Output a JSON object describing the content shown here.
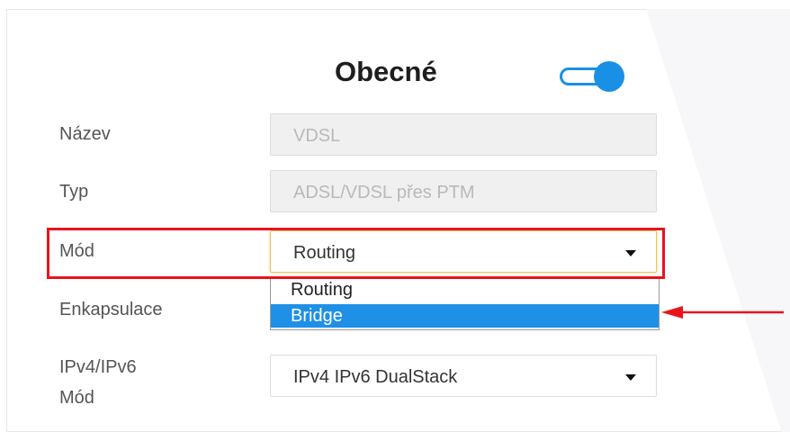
{
  "section": {
    "title": "Obecné",
    "enabled": true
  },
  "form": {
    "name": {
      "label": "Název",
      "value": "VDSL"
    },
    "type": {
      "label": "Typ",
      "value": "ADSL/VDSL přes PTM"
    },
    "mode": {
      "label": "Mód",
      "value": "Routing",
      "options": [
        {
          "label": "Routing",
          "selected": false
        },
        {
          "label": "Bridge",
          "selected": true
        }
      ]
    },
    "encapsulation": {
      "label": "Enkapsulace"
    },
    "ip_mode": {
      "label_line1": "IPv4/IPv6",
      "label_line2": "Mód",
      "value": "IPv4 IPv6 DualStack"
    }
  },
  "annotations": {
    "highlight_color": "#e8141c",
    "arrow_color": "#e8141c",
    "accent_color": "#1a8fe6"
  }
}
